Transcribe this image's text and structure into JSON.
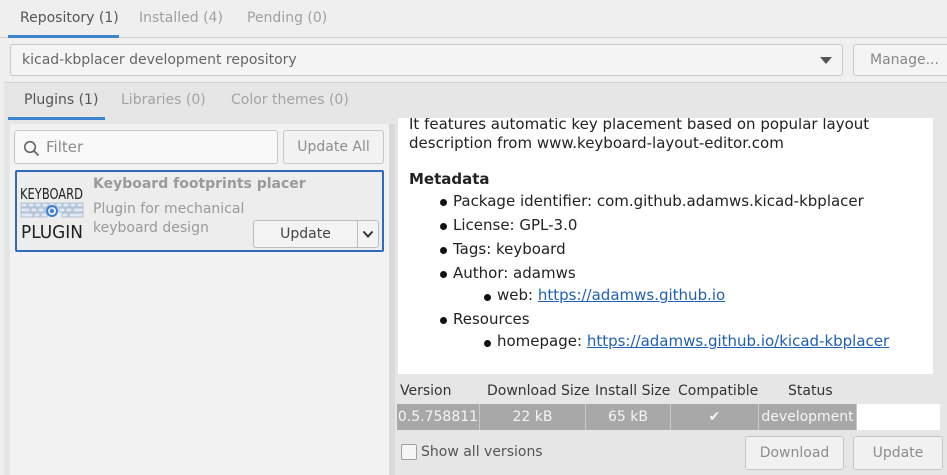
{
  "top_tabs": [
    "Repository (1)",
    "Installed (4)",
    "Pending (0)"
  ],
  "repository": {
    "selected": "kicad-kbplacer development repository",
    "manage_label": "Manage..."
  },
  "inner_tabs": [
    "Plugins (1)",
    "Libraries (0)",
    "Color themes (0)"
  ],
  "filter": {
    "placeholder": "Filter",
    "update_all_label": "Update All"
  },
  "package": {
    "logo_lines": [
      "KEYBOARD",
      "PLUGIN"
    ],
    "title": "Keyboard footprints placer",
    "description": "Plugin for mechanical keyboard design",
    "update_label": "Update"
  },
  "details": {
    "intro_line1": "It features automatic key placement based on popular layout",
    "intro_line2": "description from www.keyboard-layout-editor.com",
    "metadata_heading": "Metadata",
    "package_identifier": "Package identifier: com.github.adamws.kicad-kbplacer",
    "license": "License: GPL-3.0",
    "tags": "Tags: keyboard",
    "author": "Author: adamws",
    "web_label": "web: ",
    "web_url": "https://adamws.github.io",
    "resources": "Resources",
    "homepage_label": "homepage: ",
    "homepage_url": "https://adamws.github.io/kicad-kbplacer"
  },
  "versions": {
    "headers": [
      "Version",
      "Download Size",
      "Install Size",
      "Compatible",
      "Status"
    ],
    "rows": [
      {
        "version": "0.5.758811",
        "download_size": "22 kB",
        "install_size": "65 kB",
        "compatible": "✔",
        "status": "development"
      }
    ]
  },
  "show_all_versions_label": "Show all versions",
  "download_label": "Download",
  "update_label": "Update",
  "colors": {
    "accent": "#3c84cf",
    "selection_border": "#2f6bb8",
    "link": "#1f5fb5"
  }
}
